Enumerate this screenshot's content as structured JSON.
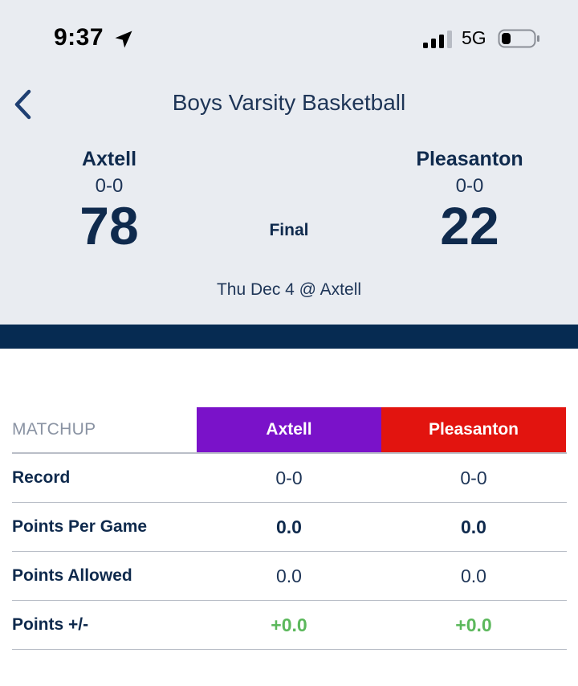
{
  "status_bar": {
    "time": "9:37",
    "network": "5G"
  },
  "header": {
    "title": "Boys Varsity Basketball"
  },
  "game": {
    "home": {
      "name": "Axtell",
      "record": "0-0",
      "score": "78"
    },
    "away": {
      "name": "Pleasanton",
      "record": "0-0",
      "score": "22"
    },
    "status": "Final",
    "info": "Thu Dec 4 @ Axtell"
  },
  "matchup": {
    "header_label": "MATCHUP",
    "team1": "Axtell",
    "team2": "Pleasanton",
    "team1_color": "#7a12c9",
    "team2_color": "#e2140f",
    "rows": [
      {
        "label": "Record",
        "v1": "0-0",
        "v2": "0-0"
      },
      {
        "label": "Points Per Game",
        "v1": "0.0",
        "v2": "0.0"
      },
      {
        "label": "Points Allowed",
        "v1": "0.0",
        "v2": "0.0"
      },
      {
        "label": "Points +/-",
        "v1": "+0.0",
        "v2": "+0.0"
      }
    ]
  },
  "icons": [
    "location-arrow-icon",
    "signal-icon",
    "battery-icon",
    "chevron-left-icon"
  ]
}
